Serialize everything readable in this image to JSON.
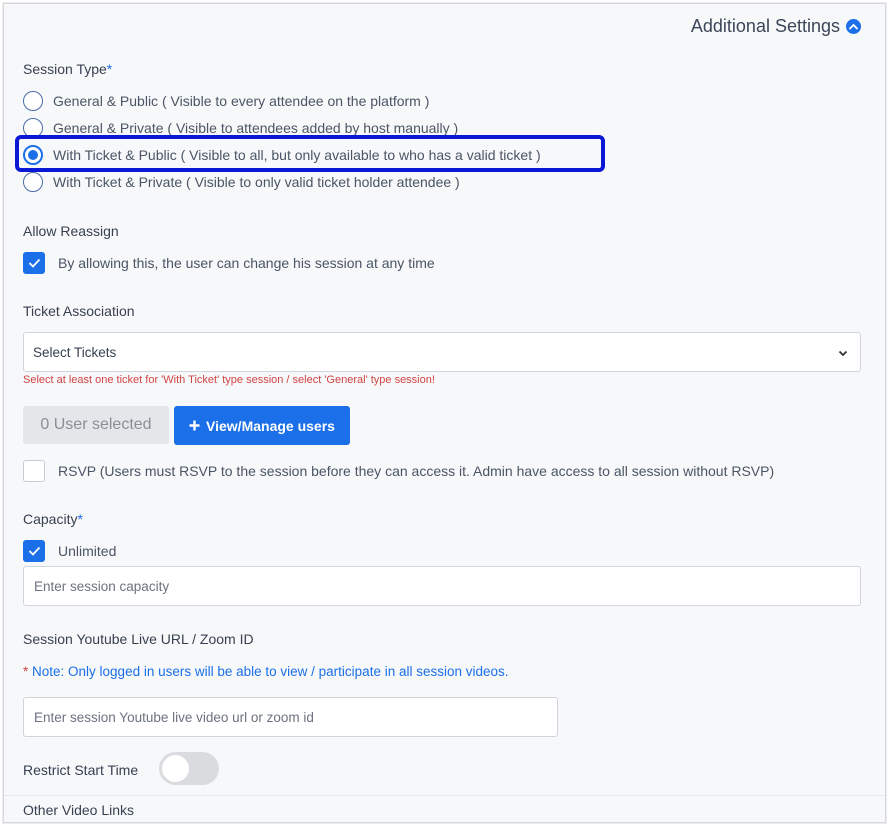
{
  "header": {
    "title": "Additional Settings",
    "toggle_icon": "chevron-up-circle-icon"
  },
  "session_type": {
    "label": "Session Type",
    "required_mark": "*",
    "options": [
      {
        "label": "General & Public ( Visible to every attendee on the platform )",
        "checked": false
      },
      {
        "label": "General & Private ( Visible to attendees added by host manually )",
        "checked": false
      },
      {
        "label": "With Ticket & Public ( Visible to all, but only available to who has a valid ticket )",
        "checked": true
      },
      {
        "label": "With Ticket & Private ( Visible to only valid ticket holder attendee )",
        "checked": false
      }
    ]
  },
  "allow_reassign": {
    "label": "Allow Reassign",
    "checkbox_label": "By allowing this, the user can change his session at any time",
    "checked": true
  },
  "ticket_association": {
    "label": "Ticket Association",
    "select_value": "Select Tickets",
    "error": "Select at least one ticket for 'With Ticket' type session / select 'General' type session!"
  },
  "users": {
    "count_label": "0 User selected",
    "manage_button": "View/Manage users"
  },
  "rsvp": {
    "label": "RSVP (Users must RSVP to the session before they can access it. Admin have access to all session without RSVP)",
    "checked": false
  },
  "capacity": {
    "label": "Capacity",
    "required_mark": "*",
    "unlimited_label": "Unlimited",
    "unlimited_checked": true,
    "placeholder": "Enter session capacity"
  },
  "video": {
    "label": "Session Youtube Live URL / Zoom ID",
    "note_star": "*",
    "note": " Note: Only logged in users will be able to view / participate in all session videos.",
    "placeholder": "Enter session Youtube live video url or zoom id"
  },
  "restrict_start": {
    "label": "Restrict Start Time",
    "enabled": false
  },
  "other_links": {
    "label": "Other Video Links"
  },
  "colors": {
    "accent": "#1b6fe8",
    "highlight": "#0a18d6",
    "error": "#d14444"
  }
}
